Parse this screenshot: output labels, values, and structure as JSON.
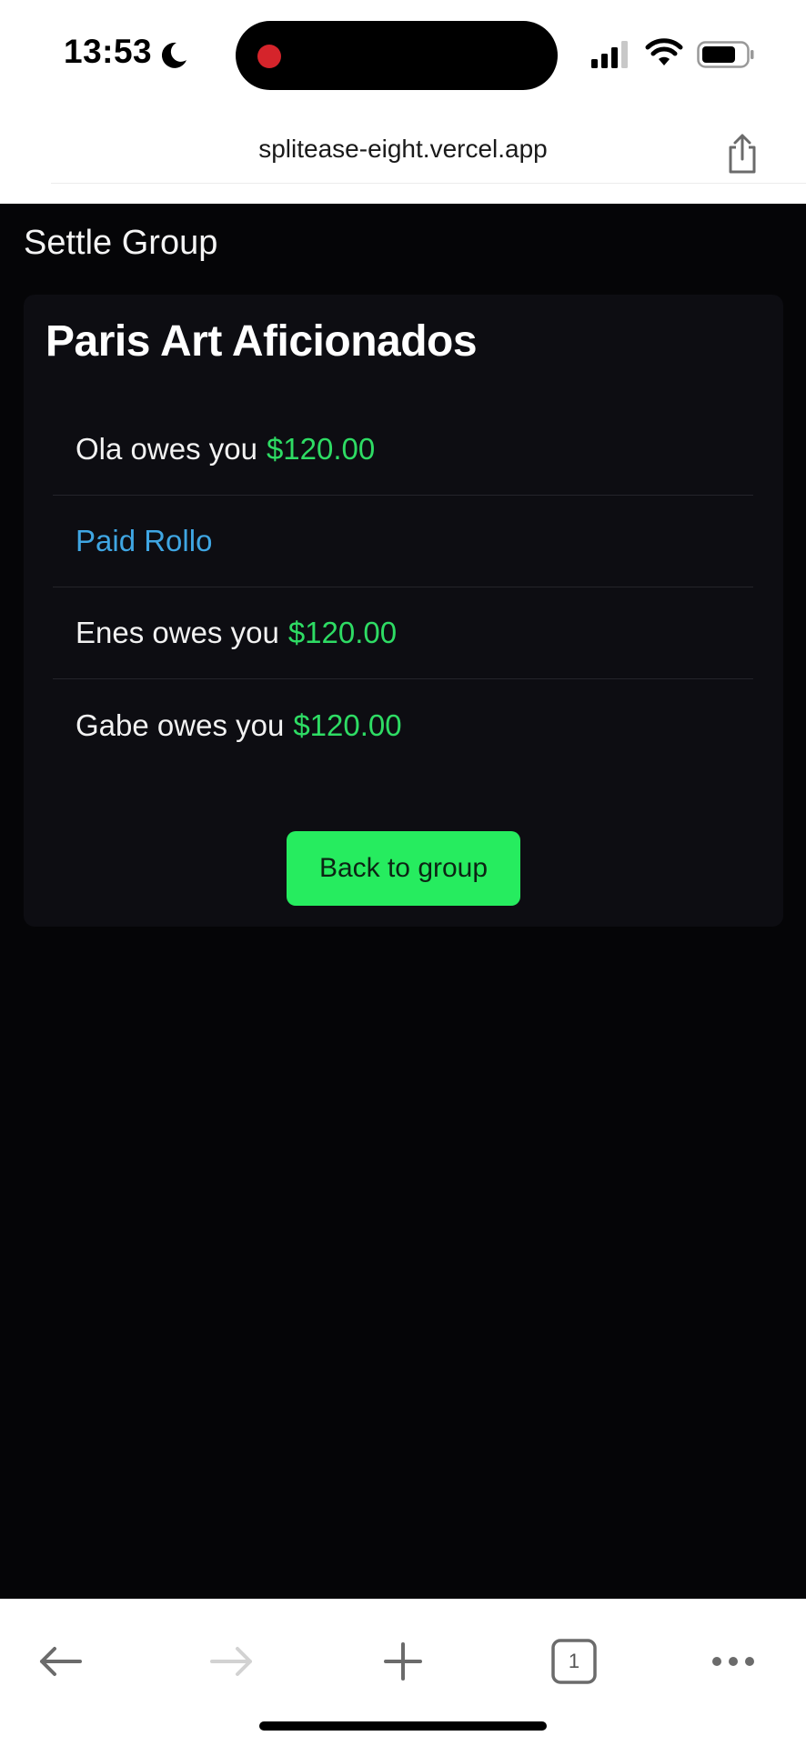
{
  "status_bar": {
    "time": "13:53",
    "icons": [
      "moon-icon",
      "signal-icon",
      "wifi-icon",
      "battery-icon"
    ],
    "recording_color": "#d5242b"
  },
  "browser": {
    "url": "splitease-eight.vercel.app",
    "share_icon": "share-icon",
    "tab_count": "1",
    "toolbar_icons": [
      "back-arrow-icon",
      "forward-arrow-icon",
      "plus-icon",
      "tabs-icon",
      "more-icon"
    ]
  },
  "page": {
    "heading": "Settle Group",
    "group_name": "Paris Art Aficionados",
    "settlements": [
      {
        "name": "Ola",
        "text": "owes you",
        "amount": "$120.00"
      },
      {
        "label": "Paid Rollo"
      },
      {
        "name": "Enes",
        "text": "owes you",
        "amount": "$120.00"
      },
      {
        "name": "Gabe",
        "text": "owes you",
        "amount": "$120.00"
      }
    ],
    "back_button_label": "Back to group"
  },
  "colors": {
    "background": "#050507",
    "card": "#0d0d12",
    "amount_green": "#2edc64",
    "paid_blue": "#3fa6e3",
    "button_green": "#26ec5f"
  }
}
